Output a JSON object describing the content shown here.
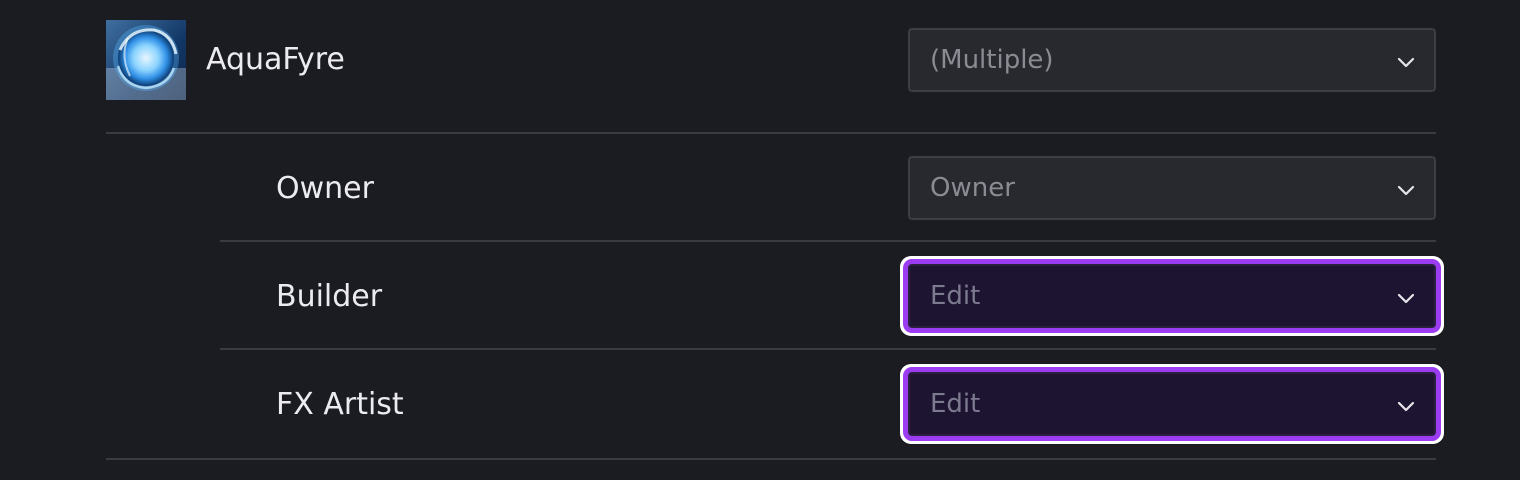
{
  "group": {
    "name": "AquaFyre",
    "role_select": {
      "value": "(Multiple)"
    }
  },
  "roles": [
    {
      "label": "Owner",
      "select_value": "Owner",
      "focused": false
    },
    {
      "label": "Builder",
      "select_value": "Edit",
      "focused": true
    },
    {
      "label": "FX Artist",
      "select_value": "Edit",
      "focused": true
    }
  ],
  "colors": {
    "background": "#1b1c21",
    "select_bg": "#28292f",
    "focus_ring": "#9b3cf2",
    "focus_outline": "#ffffff"
  },
  "icons": {
    "dropdown": "chevron-down-icon",
    "avatar": "group-avatar-orb"
  }
}
